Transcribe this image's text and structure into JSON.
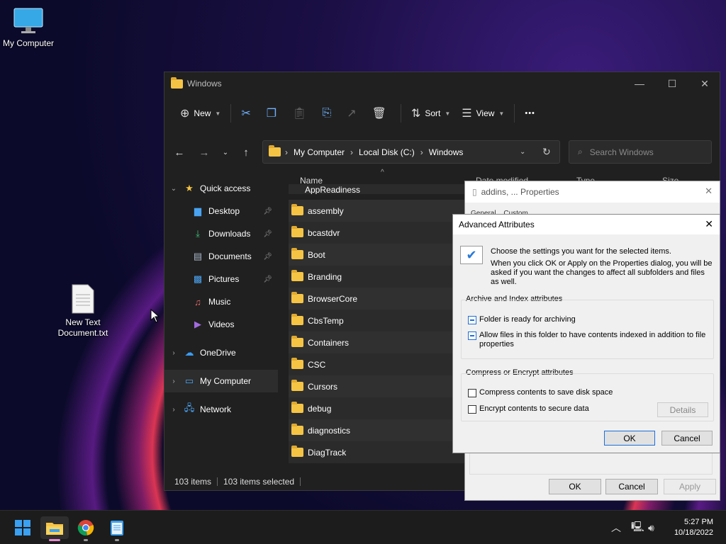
{
  "desktop": {
    "my_computer_label": "My Computer",
    "text_doc_label_line1": "New Text",
    "text_doc_label_line2": "Document.txt"
  },
  "explorer": {
    "title": "Windows",
    "toolbar": {
      "new_label": "New",
      "sort_label": "Sort",
      "view_label": "View",
      "more_label": "•••"
    },
    "address": {
      "crumbs": [
        "My Computer",
        "Local Disk (C:)",
        "Windows"
      ]
    },
    "search_placeholder": "Search Windows",
    "nav": {
      "quick_access": "Quick access",
      "desktop": "Desktop",
      "downloads": "Downloads",
      "documents": "Documents",
      "pictures": "Pictures",
      "music": "Music",
      "videos": "Videos",
      "onedrive": "OneDrive",
      "my_computer": "My Computer",
      "network": "Network"
    },
    "columns": {
      "name": "Name",
      "date_modified": "Date modified",
      "type": "Type",
      "size": "Size"
    },
    "partial_top_row": "AppReadiness",
    "files": [
      "assembly",
      "bcastdvr",
      "Boot",
      "Branding",
      "BrowserCore",
      "CbsTemp",
      "Containers",
      "CSC",
      "Cursors",
      "debug",
      "diagnostics",
      "DiagTrack"
    ],
    "status": {
      "item_count": "103 items",
      "selected_count": "103 items selected"
    }
  },
  "properties_dialog": {
    "title": "addins, ... Properties",
    "tab_general": "General",
    "tab_custom": "Custom",
    "ok": "OK",
    "cancel": "Cancel",
    "apply": "Apply"
  },
  "advanced_dialog": {
    "title": "Advanced Attributes",
    "intro": "Choose the settings you want for the selected items.",
    "note": "When you click OK or Apply on the Properties dialog, you will be asked if you want the changes to affect all subfolders and files as well.",
    "archive_group": "Archive and Index attributes",
    "archive_cb": "Folder is ready for archiving",
    "index_cb": "Allow files in this folder to have contents indexed in addition to file properties",
    "compress_group": "Compress or Encrypt attributes",
    "compress_cb": "Compress contents to save disk space",
    "encrypt_cb": "Encrypt contents to secure data",
    "details": "Details",
    "ok": "OK",
    "cancel": "Cancel"
  },
  "taskbar": {
    "time": "5:27 PM",
    "date": "10/18/2022"
  },
  "colors": {
    "accent": "#1e6fd9",
    "folder": "#f6c445",
    "explorer_bg": "#202020"
  }
}
